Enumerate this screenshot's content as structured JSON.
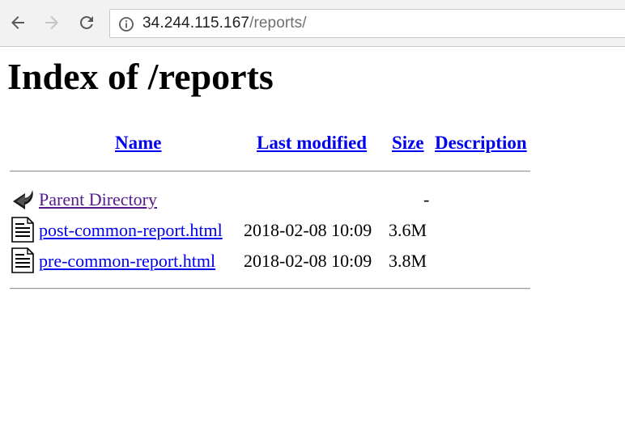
{
  "browser": {
    "url_host": "34.244.115.167",
    "url_path": "/reports/"
  },
  "page": {
    "title": "Index of /reports"
  },
  "table": {
    "headers": {
      "name": "Name",
      "last_modified": "Last modified",
      "size": "Size",
      "description": "Description"
    },
    "rows": [
      {
        "icon": "back-icon",
        "name": "Parent Directory",
        "modified": "",
        "size": "-",
        "description": ""
      },
      {
        "icon": "text-file-icon",
        "name": "post-common-report.html",
        "modified": "2018-02-08 10:09",
        "size": "3.6M",
        "description": ""
      },
      {
        "icon": "text-file-icon",
        "name": "pre-common-report.html",
        "modified": "2018-02-08 10:09",
        "size": "3.8M",
        "description": ""
      }
    ]
  }
}
